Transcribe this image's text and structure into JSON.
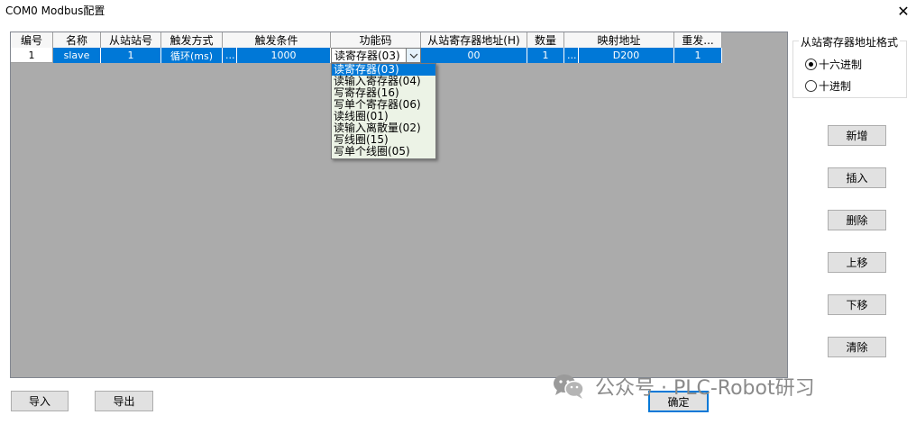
{
  "window": {
    "title": "COM0 Modbus配置",
    "close_glyph": "✕"
  },
  "table": {
    "columns": [
      "编号",
      "名称",
      "从站站号",
      "触发方式",
      "触发条件",
      "功能码",
      "从站寄存器地址(H)",
      "数量",
      "映射地址",
      "重发..."
    ],
    "row": {
      "index": "1",
      "name": "slave",
      "slave_id": "1",
      "trigger_mode": "循环(ms)",
      "trigger_dots": "...",
      "trigger_value": "1000",
      "function_code": "读寄存器(03)",
      "register_address": "00",
      "count": "1",
      "map_dots": "...",
      "map_address": "D200",
      "retry": "1"
    }
  },
  "function_dropdown": {
    "options": [
      "读寄存器(03)",
      "读输入寄存器(04)",
      "写寄存器(16)",
      "写单个寄存器(06)",
      "读线圈(01)",
      "读输入离散量(02)",
      "写线圈(15)",
      "写单个线圈(05)"
    ],
    "selected_index": 0
  },
  "register_format": {
    "legend": "从站寄存器地址格式",
    "options": [
      "十六进制",
      "十进制"
    ],
    "selected": "十六进制"
  },
  "buttons": {
    "add": "新增",
    "insert": "插入",
    "delete": "删除",
    "move_up": "上移",
    "move_down": "下移",
    "clear": "清除",
    "import": "导入",
    "export": "导出",
    "ok": "确定"
  },
  "watermark": {
    "text": "公众号 · PLC-Robot研习"
  },
  "colors": {
    "selection": "#0078d7",
    "grid_bg": "#ababab",
    "dropdown_bg": "#ecf3e6"
  },
  "icons": {
    "close": "close-icon",
    "combo_arrow": "chevron-down-icon",
    "watermark": "wechat-icon"
  }
}
